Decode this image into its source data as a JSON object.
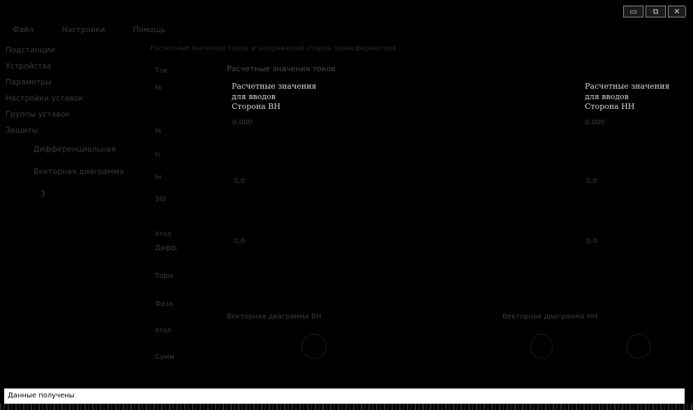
{
  "window": {
    "title": "",
    "controls": {
      "minimize_icon": "minimize-icon",
      "maximize_icon": "maximize-icon",
      "close_icon": "close-icon",
      "minimize_glyph": "▭",
      "maximize_glyph": "⧉",
      "close_glyph": "✕"
    }
  },
  "menu": {
    "items": [
      "Файл",
      "Настройки",
      "Помощь"
    ]
  },
  "sidebar": {
    "items": [
      {
        "label": "Подстанции",
        "level": 0
      },
      {
        "label": "Устройства",
        "level": 0
      },
      {
        "label": "Параметры",
        "level": 0
      },
      {
        "label": "Настройки уставок",
        "level": 0
      },
      {
        "label": "Группы уставок",
        "level": 0
      },
      {
        "label": "Защиты",
        "level": 0
      },
      {
        "label": "Дифференциальная",
        "level": 1
      },
      {
        "label": "Векторная диаграмма",
        "level": 1
      },
      {
        "label": "3",
        "level": 2
      }
    ]
  },
  "main": {
    "headline": "Расчетные значения токов и напряжений сторон трансформатора",
    "section_title": "Расчетные значения токов",
    "row_labels": [
      "Ток",
      "Iа",
      "Iв",
      "Iс",
      "Iн",
      "3I0",
      "Угол",
      "Дифф",
      "Торм",
      "Фаза",
      "Угол",
      "Сумм"
    ],
    "left_header": "Расчетные значения\nдля вводов\nСторона ВН",
    "right_header": "Расчетные значения\nдля вводов\nСторона НН",
    "left_values": [
      "0,000",
      "0,0",
      "0,0"
    ],
    "right_values": [
      "0,000",
      "0,0",
      "0,0"
    ],
    "vector_left_label": "Векторная диаграмма ВН",
    "vector_right_label": "Векторная диаграмма НН"
  },
  "status": {
    "text": "Данные получены"
  },
  "colors": {
    "background": "#000000",
    "statusbar_bg": "#ffffff",
    "header_text": "#d8d8d8",
    "dim_text": "#3a3a3a"
  }
}
